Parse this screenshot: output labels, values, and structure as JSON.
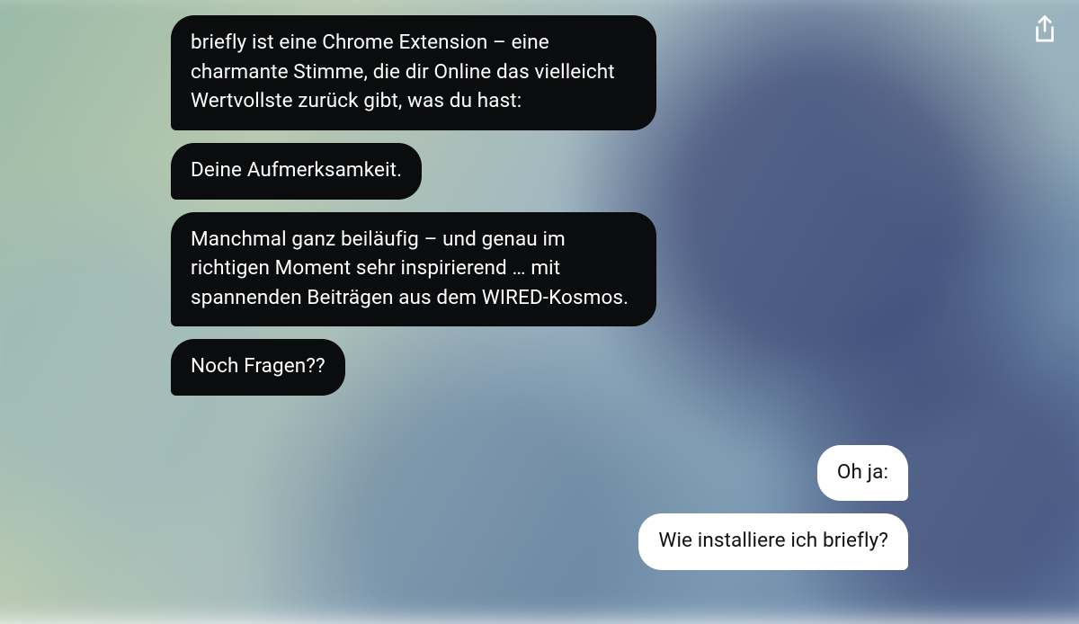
{
  "share_label": "Share",
  "messages": [
    {
      "side": "left",
      "text": "briefly ist eine Chrome Extension – eine charmante Stimme, die dir Online das vielleicht Wertvollste zurück gibt, was du hast:"
    },
    {
      "side": "left",
      "text": "Deine Aufmerksamkeit."
    },
    {
      "side": "left",
      "text": "Manchmal ganz beiläufig – und genau im richtigen Moment sehr inspirierend … mit spannenden Beiträgen aus dem WIRED-Kosmos."
    },
    {
      "side": "left",
      "text": "Noch Fragen??"
    },
    {
      "side": "right",
      "text": "Oh ja:"
    },
    {
      "side": "right",
      "text": "Wie installiere ich briefly?"
    }
  ]
}
